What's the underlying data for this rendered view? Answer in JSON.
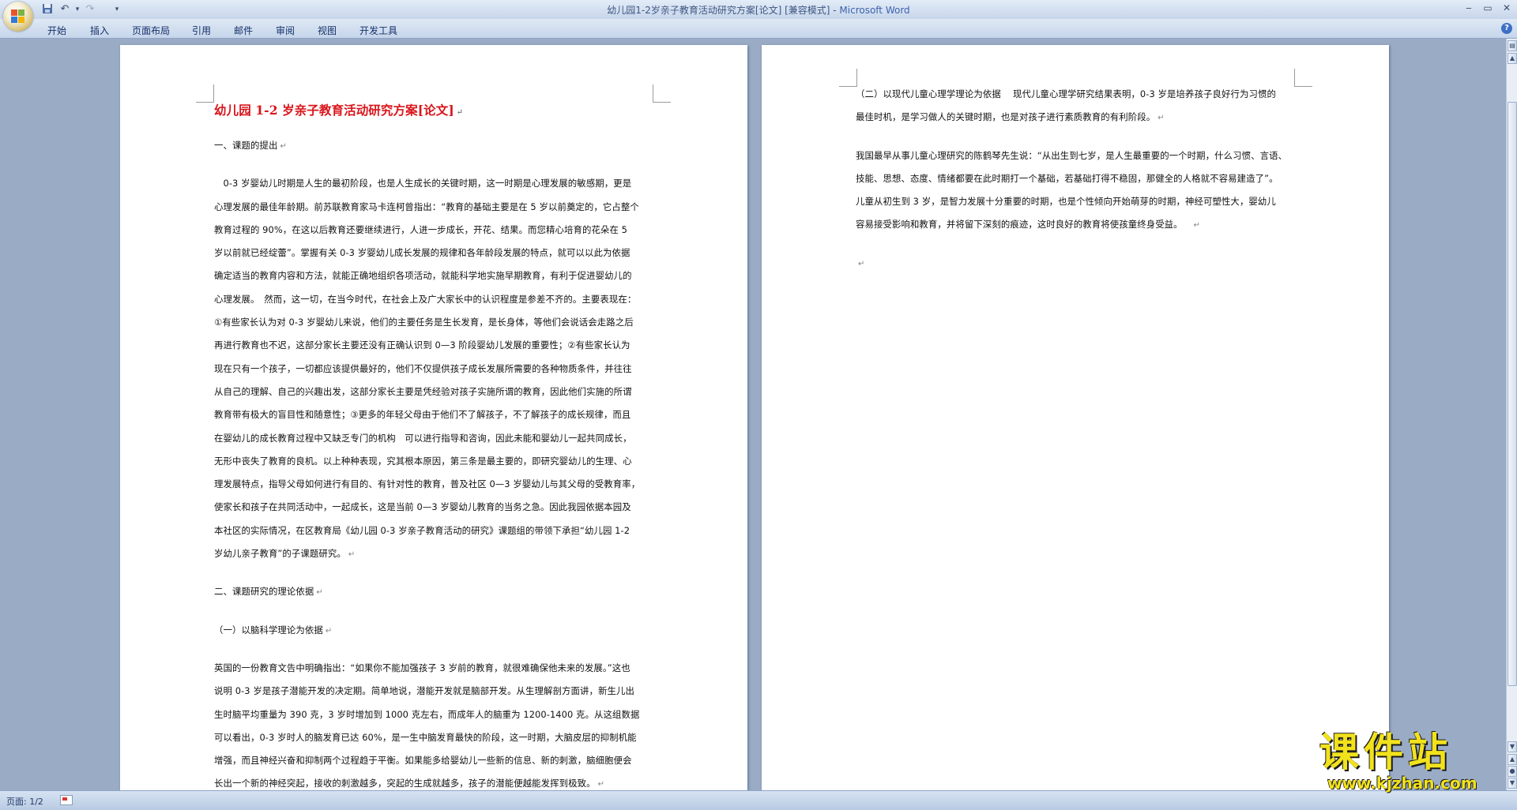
{
  "window": {
    "title": "幼儿园1-2岁亲子教育活动研究方案[论文] [兼容模式] - ",
    "app": "Microsoft Word",
    "minimize": "‒",
    "maximize": "▭",
    "close": "✕"
  },
  "quick_access": [
    "save-icon",
    "undo-icon",
    "redo-icon",
    "customize-icon"
  ],
  "ribbon": {
    "tabs": [
      "开始",
      "插入",
      "页面布局",
      "引用",
      "邮件",
      "审阅",
      "视图",
      "开发工具"
    ],
    "help": "?"
  },
  "page1": {
    "title": "幼儿园 1-2 岁亲子教育活动研究方案[论文]",
    "h1": "一、课题的提出",
    "p1": [
      "　0-3 岁婴幼儿时期是人生的最初阶段，也是人生成长的关键时期，这一时期是心理发展的敏感期，更是",
      "心理发展的最佳年龄期。前苏联教育家马卡连柯曾指出：“教育的基础主要是在 5 岁以前奠定的，它占整个",
      "教育过程的 90%，在这以后教育还要继续进行，人进一步成长，开花、结果。而您精心培育的花朵在 5",
      "岁以前就已经绽蕾”。掌握有关 0-3 岁婴幼儿成长发展的规律和各年龄段发展的特点，就可以以此为依据",
      "确定适当的教育内容和方法，就能正确地组织各项活动，就能科学地实施早期教育，有利于促进婴幼儿的",
      "心理发展。　然而，这一切，在当今时代，在社会上及广大家长中的认识程度是参差不齐的。主要表现在：",
      "①有些家长认为对 0-3 岁婴幼儿来说，他们的主要任务是生长发育，是长身体，等他们会说话会走路之后",
      "再进行教育也不迟，这部分家长主要还没有正确认识到 0—3 阶段婴幼儿发展的重要性；②有些家长认为",
      "现在只有一个孩子，一切都应该提供最好的，他们不仅提供孩子成长发展所需要的各种物质条件，并往往",
      "从自己的理解、自己的兴趣出发，这部分家长主要是凭经验对孩子实施所谓的教育，因此他们实施的所谓",
      "教育带有极大的盲目性和随意性；③更多的年轻父母由于他们不了解孩子，不了解孩子的成长规律，而且",
      "在婴幼儿的成长教育过程中又缺乏专门的机构　可以进行指导和咨询，因此未能和婴幼儿一起共同成长，",
      "无形中丧失了教育的良机。以上种种表现，究其根本原因，第三条是最主要的，即研究婴幼儿的生理、心",
      "理发展特点，指导父母如何进行有目的、有针对性的教育，普及社区 0—3 岁婴幼儿与其父母的受教育率，",
      "使家长和孩子在共同活动中，一起成长，这是当前 0—3 岁婴幼儿教育的当务之急。因此我园依据本园及",
      "本社区的实际情况，在区教育局《幼儿园 0-3 岁亲子教育活动的研究》课题组的带领下承担“幼儿园 1-2",
      "岁幼儿亲子教育”的子课题研究。"
    ],
    "h2": "二、课题研究的理论依据",
    "h3": "（一）以脑科学理论为依据",
    "p2": [
      "英国的一份教育文告中明确指出：“如果你不能加强孩子 3 岁前的教育，就很难确保他未来的发展。”这也",
      "说明 0-3 岁是孩子潜能开发的决定期。简单地说，潜能开发就是脑部开发。从生理解剖方面讲，新生儿出",
      "生时脑平均重量为 390 克，3 岁时增加到 1000 克左右，而成年人的脑重为 1200-1400 克。从这组数据",
      "可以看出，0-3 岁时人的脑发育已达 60%，是一生中脑发育最快的阶段，这一时期，大脑皮层的抑制机能",
      "增强，而且神经兴奋和抑制两个过程趋于平衡。如果能多给婴幼儿一些新的信息、新的刺激，脑细胞便会",
      "长出一个新的神经突起，接收的刺激越多，突起的生成就越多，孩子的潜能便越能发挥到极致。"
    ]
  },
  "page2": {
    "p1": [
      "（二）以现代儿童心理学理论为依据　 现代儿童心理学研究结果表明，0-3 岁是培养孩子良好行为习惯的",
      "最佳时机，是学习做人的关键时期，也是对孩子进行素质教育的有利阶段。"
    ],
    "p2": [
      "我国最早从事儿童心理研究的陈鹤琴先生说：“从出生到七岁，是人生最重要的一个时期，什么习惯、言语、",
      "技能、思想、态度、情绪都要在此时期打一个基础，若基础打得不稳固，那健全的人格就不容易建造了”。",
      "儿童从初生到 3 岁，是智力发展十分重要的时期，也是个性倾向开始萌芽的时期，神经可塑性大，婴幼儿",
      "容易接受影响和教育，并将留下深刻的痕迹，这时良好的教育将使孩童终身受益。"
    ]
  },
  "paragraph_mark": "↵",
  "status": {
    "page": "页面: 1/2"
  },
  "watermark": {
    "title": "课件站",
    "url": "www.kjzhan.com"
  }
}
